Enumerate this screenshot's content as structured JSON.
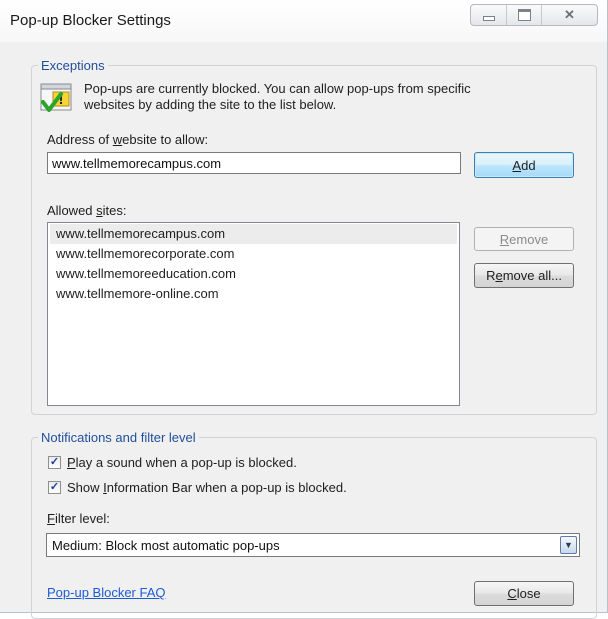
{
  "window": {
    "title": "Pop-up Blocker Settings"
  },
  "exceptions": {
    "legend": "Exceptions",
    "info_line1": "Pop-ups are currently blocked.  You can allow pop-ups from specific",
    "info_line2": "websites by adding the site to the list below.",
    "address_label_pre": "Address of ",
    "address_label_u": "w",
    "address_label_post": "ebsite to allow:",
    "address_value": "www.tellmemorecampus.com",
    "add_button_u": "A",
    "add_button_rest": "dd",
    "allowed_label_pre": "Allowed ",
    "allowed_label_u": "s",
    "allowed_label_post": "ites:",
    "allowed_sites": [
      "www.tellmemorecampus.com",
      "www.tellmemorecorporate.com",
      "www.tellmemoreeducation.com",
      "www.tellmemore-online.com"
    ],
    "remove_button_u": "R",
    "remove_button_rest": "emove",
    "remove_all_button_u": "e",
    "remove_all_button_pre": "R",
    "remove_all_button_rest": "move all..."
  },
  "notifications": {
    "legend": "Notifications and filter level",
    "play_sound_u": "P",
    "play_sound_rest": "lay a sound when a pop-up is blocked.",
    "play_sound_checked": true,
    "show_bar_pre": "Show ",
    "show_bar_u": "I",
    "show_bar_rest": "nformation Bar when a pop-up is blocked.",
    "show_bar_checked": true,
    "filter_label_u": "F",
    "filter_label_rest": "ilter level:",
    "filter_value": "Medium: Block most automatic pop-ups"
  },
  "footer": {
    "faq_link": "Pop-up Blocker FAQ",
    "close_button_u": "C",
    "close_button_rest": "lose"
  }
}
